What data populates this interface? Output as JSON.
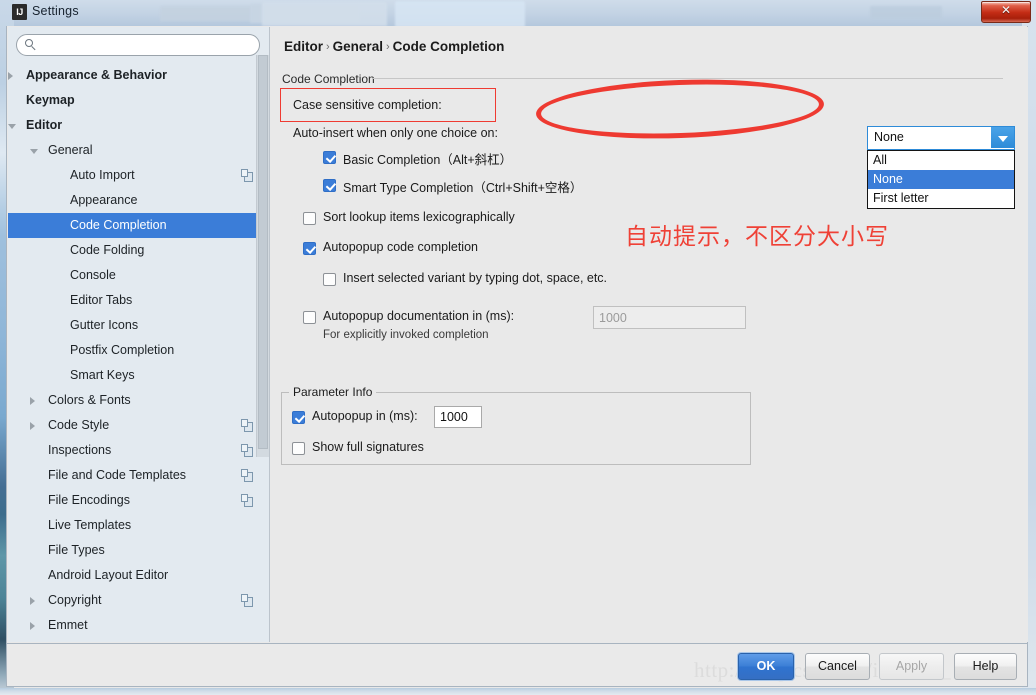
{
  "window": {
    "title": "Settings",
    "app_icon": "IJ",
    "close_label": "✕"
  },
  "sidebar": {
    "search_placeholder": "",
    "search_value": "",
    "items": [
      {
        "label": "Appearance & Behavior",
        "indent": 1,
        "arrow": "collapsed",
        "bold": true,
        "copy": false,
        "selected": false
      },
      {
        "label": "Keymap",
        "indent": 1,
        "arrow": "none",
        "bold": true,
        "copy": false,
        "selected": false
      },
      {
        "label": "Editor",
        "indent": 1,
        "arrow": "expanded",
        "bold": true,
        "copy": false,
        "selected": false
      },
      {
        "label": "General",
        "indent": 2,
        "arrow": "expanded",
        "bold": false,
        "copy": false,
        "selected": false
      },
      {
        "label": "Auto Import",
        "indent": 3,
        "arrow": "none",
        "bold": false,
        "copy": true,
        "selected": false
      },
      {
        "label": "Appearance",
        "indent": 3,
        "arrow": "none",
        "bold": false,
        "copy": false,
        "selected": false
      },
      {
        "label": "Code Completion",
        "indent": 3,
        "arrow": "none",
        "bold": false,
        "copy": false,
        "selected": true
      },
      {
        "label": "Code Folding",
        "indent": 3,
        "arrow": "none",
        "bold": false,
        "copy": false,
        "selected": false
      },
      {
        "label": "Console",
        "indent": 3,
        "arrow": "none",
        "bold": false,
        "copy": false,
        "selected": false
      },
      {
        "label": "Editor Tabs",
        "indent": 3,
        "arrow": "none",
        "bold": false,
        "copy": false,
        "selected": false
      },
      {
        "label": "Gutter Icons",
        "indent": 3,
        "arrow": "none",
        "bold": false,
        "copy": false,
        "selected": false
      },
      {
        "label": "Postfix Completion",
        "indent": 3,
        "arrow": "none",
        "bold": false,
        "copy": false,
        "selected": false
      },
      {
        "label": "Smart Keys",
        "indent": 3,
        "arrow": "none",
        "bold": false,
        "copy": false,
        "selected": false
      },
      {
        "label": "Colors & Fonts",
        "indent": 2,
        "arrow": "collapsed",
        "bold": false,
        "copy": false,
        "selected": false
      },
      {
        "label": "Code Style",
        "indent": 2,
        "arrow": "collapsed",
        "bold": false,
        "copy": true,
        "selected": false
      },
      {
        "label": "Inspections",
        "indent": 2,
        "arrow": "none",
        "bold": false,
        "copy": true,
        "selected": false
      },
      {
        "label": "File and Code Templates",
        "indent": 2,
        "arrow": "none",
        "bold": false,
        "copy": true,
        "selected": false
      },
      {
        "label": "File Encodings",
        "indent": 2,
        "arrow": "none",
        "bold": false,
        "copy": true,
        "selected": false
      },
      {
        "label": "Live Templates",
        "indent": 2,
        "arrow": "none",
        "bold": false,
        "copy": false,
        "selected": false
      },
      {
        "label": "File Types",
        "indent": 2,
        "arrow": "none",
        "bold": false,
        "copy": false,
        "selected": false
      },
      {
        "label": "Android Layout Editor",
        "indent": 2,
        "arrow": "none",
        "bold": false,
        "copy": false,
        "selected": false
      },
      {
        "label": "Copyright",
        "indent": 2,
        "arrow": "collapsed",
        "bold": false,
        "copy": true,
        "selected": false
      },
      {
        "label": "Emmet",
        "indent": 2,
        "arrow": "collapsed",
        "bold": false,
        "copy": false,
        "selected": false
      }
    ]
  },
  "breadcrumb": {
    "part1": "Editor",
    "part2": "General",
    "part3": "Code Completion",
    "separator": "›"
  },
  "main": {
    "group_title": "Code Completion",
    "case_sensitive_label": "Case sensitive completion:",
    "auto_insert_label": "Auto-insert when only one choice on:",
    "basic_completion": {
      "label": "Basic Completion（Alt+斜杠）",
      "checked": true
    },
    "smart_type_completion": {
      "label": "Smart Type Completion（Ctrl+Shift+空格）",
      "checked": true
    },
    "sort_lookup": {
      "label": "Sort lookup items lexicographically",
      "checked": false
    },
    "autopopup_code": {
      "label": "Autopopup code completion",
      "checked": true
    },
    "insert_variant": {
      "label": "Insert selected variant by typing dot, space, etc.",
      "checked": false
    },
    "autopopup_doc": {
      "label": "Autopopup documentation in (ms):",
      "checked": false
    },
    "autopopup_doc_value": "1000",
    "autopopup_doc_hint": "For explicitly invoked completion",
    "combo": {
      "value": "None",
      "options": [
        {
          "label": "All",
          "selected": false
        },
        {
          "label": "None",
          "selected": true
        },
        {
          "label": "First letter",
          "selected": false
        }
      ]
    },
    "parameter_info": {
      "title": "Parameter Info",
      "autopopup": {
        "label": "Autopopup in (ms):",
        "checked": true
      },
      "autopopup_value": "1000",
      "show_full_signatures": {
        "label": "Show full signatures",
        "checked": false
      }
    }
  },
  "annotation": {
    "text": "自动提示，不区分大小写",
    "color": "#ef4136"
  },
  "watermark": {
    "text": "http://blog.csdn.net/icecode_"
  },
  "buttons": {
    "ok": "OK",
    "cancel": "Cancel",
    "apply": "Apply",
    "help": "Help"
  },
  "colors": {
    "accent": "#3b7dd8",
    "highlight_red": "#ef3b32",
    "panel_bg": "#e9e9e9",
    "sidebar_bg": "#e3eaf0"
  }
}
